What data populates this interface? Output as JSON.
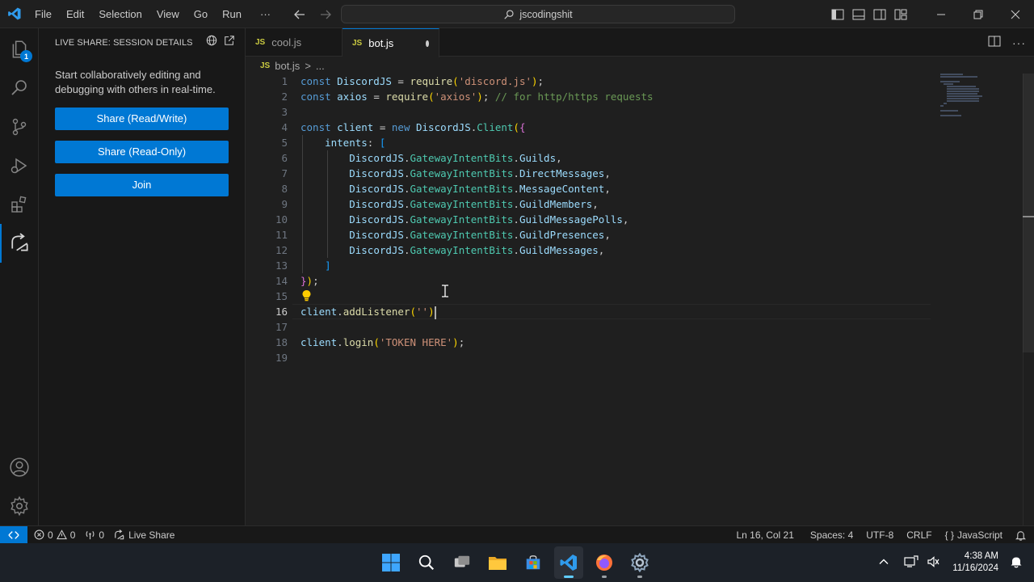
{
  "menu": [
    "File",
    "Edit",
    "Selection",
    "View",
    "Go",
    "Run",
    "···"
  ],
  "command_center": {
    "text": "jscodingshit"
  },
  "sidebar": {
    "title": "LIVE SHARE: SESSION DETAILS",
    "description": "Start collaboratively editing and debugging with others in real-time.",
    "buttons": [
      "Share (Read/Write)",
      "Share (Read-Only)",
      "Join"
    ]
  },
  "activity": {
    "explorer_badge": "1"
  },
  "tabs": [
    {
      "icon": "JS",
      "label": "cool.js"
    },
    {
      "icon": "JS",
      "label": "bot.js"
    }
  ],
  "breadcrumb": {
    "icon": "JS",
    "file": "bot.js",
    "sep": ">",
    "rest": "..."
  },
  "line_numbers": [
    "1",
    "2",
    "3",
    "4",
    "5",
    "6",
    "7",
    "8",
    "9",
    "10",
    "11",
    "12",
    "13",
    "14",
    "15",
    "16",
    "17",
    "18",
    "19"
  ],
  "status": {
    "errors": "0",
    "warnings": "0",
    "ports": "0",
    "live_share": "Live Share",
    "position": "Ln 16, Col 21",
    "spaces": "Spaces: 4",
    "encoding": "UTF-8",
    "eol": "CRLF",
    "language_braces": "{ }",
    "language": "JavaScript"
  },
  "clock": {
    "time": "4:38 AM",
    "date": "11/16/2024"
  },
  "colors": {
    "accent": "#0078d4",
    "editor_bg": "#1f1f1f",
    "keyword": "#569cd6",
    "string": "#ce9178",
    "comment": "#6a9955",
    "class": "#4ec9b0",
    "function": "#dcdcaa",
    "variable": "#9cdcfe"
  }
}
